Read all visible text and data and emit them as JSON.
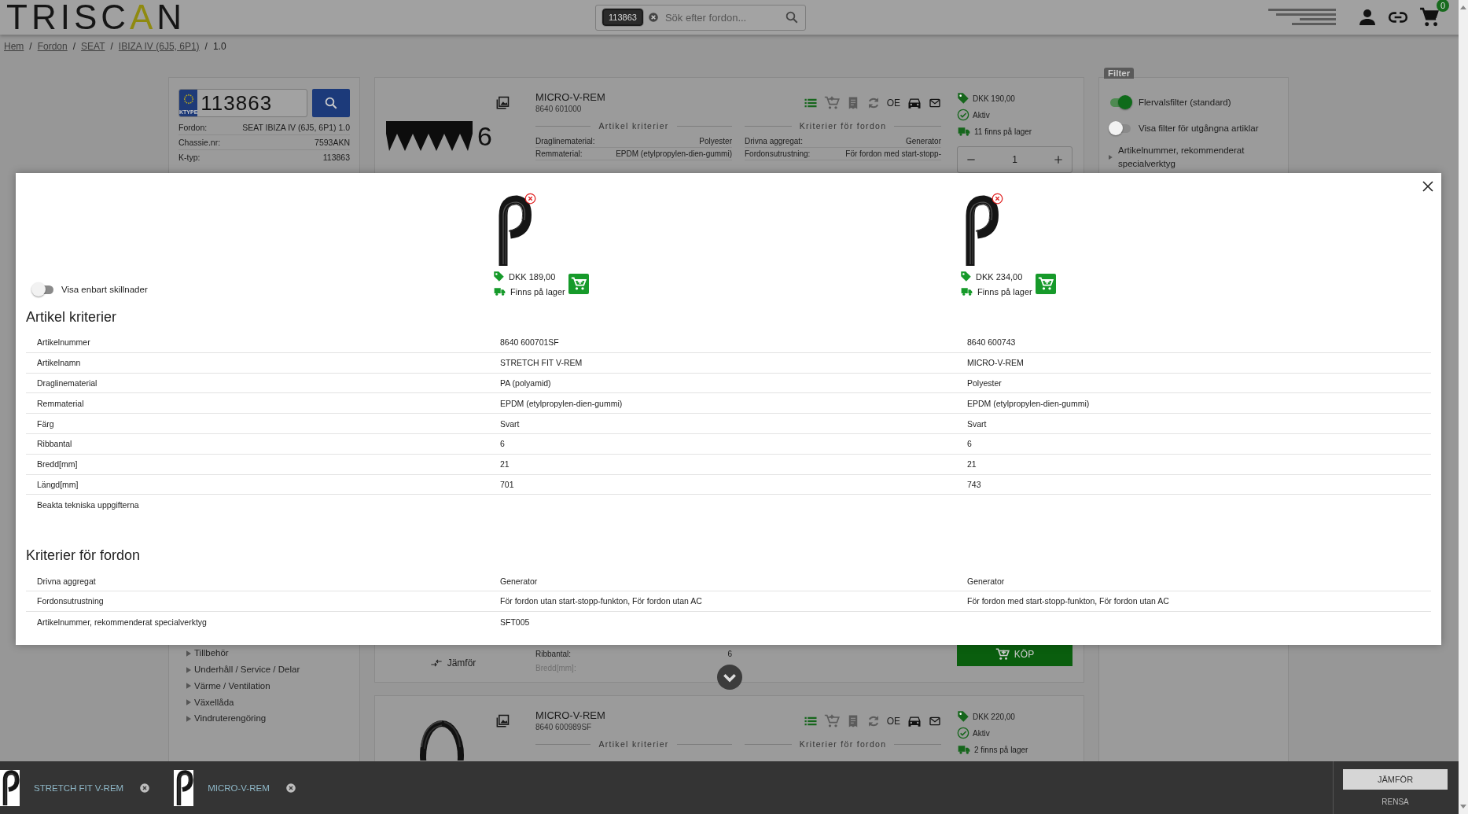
{
  "header": {
    "logo": [
      {
        "text": "TRISC",
        "accent": false
      },
      {
        "text": "A",
        "accent": true
      },
      {
        "text": "N",
        "accent": false
      }
    ],
    "search": {
      "chip": "113863",
      "placeholder": "Sök efter fordon..."
    },
    "cart_count": "0"
  },
  "breadcrumb": {
    "separator": "/",
    "items": [
      {
        "label": "Hem",
        "link": true
      },
      {
        "label": "Fordon",
        "link": true
      },
      {
        "label": "SEAT",
        "link": true
      },
      {
        "label": "IBIZA IV (6J5, 6P1)",
        "link": true
      },
      {
        "label": "1.0",
        "link": false
      }
    ]
  },
  "vehicle_panel": {
    "plate_badge": "KTYPE",
    "plate": "113863",
    "details": [
      {
        "label": "Fordon:",
        "value": "SEAT IBIZA IV (6J5, 6P1) 1.0"
      },
      {
        "label": "Chassie.nr:",
        "value": "7593AKN"
      },
      {
        "label": "K-typ:",
        "value": "113863"
      }
    ]
  },
  "categories": [
    {
      "label": "Tillbehör"
    },
    {
      "label": "Underhåll / Service / Delar"
    },
    {
      "label": "Värme / Ventilation"
    },
    {
      "label": "Växellåda"
    },
    {
      "label": "Vindruterengöring"
    }
  ],
  "products": [
    {
      "name": "MICRO-V-REM",
      "number": "8640 601000",
      "image": {
        "kind": "profile",
        "ribs": "6"
      },
      "article_heading": "Artikel kriterier",
      "vehicle_heading": "Kriterier för fordon",
      "toolbar": [
        {
          "kind": "list",
          "disabled": false
        },
        {
          "kind": "cart",
          "disabled": true
        },
        {
          "kind": "document",
          "disabled": true
        },
        {
          "kind": "refresh",
          "disabled": true
        },
        {
          "kind": "oe",
          "label": "OE",
          "disabled": false
        },
        {
          "kind": "car",
          "disabled": false
        },
        {
          "kind": "mail",
          "disabled": false
        }
      ],
      "article_criteria": [
        {
          "label": "Draglinematerial:",
          "value": "Polyester"
        },
        {
          "label": "Remmaterial:",
          "value": "EPDM (etylpropylen-dien-gummi)"
        }
      ],
      "vehicle_criteria": [
        {
          "label": "Drivna aggregat:",
          "value": "Generator"
        },
        {
          "label": "Fordonsutrustning:",
          "value": "För fordon med start-stopp-"
        }
      ],
      "price": "DKK 190,00",
      "status": "Aktiv",
      "stock": "11 finns på lager",
      "quantity": "1",
      "more_criteria": [
        {
          "label": "Ribbantal:",
          "value": "6",
          "faded": false
        },
        {
          "label": "Bredd[mm]:",
          "faded": true
        }
      ],
      "compare_label": "Jämför",
      "buy_label": "KÖP"
    },
    {
      "name": "MICRO-V-REM",
      "number": "8640 600989SF",
      "image": {
        "kind": "loop"
      },
      "article_heading": "Artikel kriterier",
      "vehicle_heading": "Kriterier för fordon",
      "toolbar": [
        {
          "kind": "list",
          "disabled": false
        },
        {
          "kind": "cart",
          "disabled": true
        },
        {
          "kind": "document",
          "disabled": true
        },
        {
          "kind": "refresh",
          "disabled": true
        },
        {
          "kind": "oe",
          "label": "OE",
          "disabled": false
        },
        {
          "kind": "car",
          "disabled": false
        },
        {
          "kind": "mail",
          "disabled": false
        }
      ],
      "price": "DKK 220,00",
      "status": "Aktiv",
      "stock": "2 finns på lager"
    }
  ],
  "filter": {
    "tag": "Filter",
    "toggles": [
      {
        "label": "Flervalsfilter (standard)",
        "on": true
      },
      {
        "label": "Visa filter för utgångna artiklar",
        "on": false
      }
    ],
    "groups": [
      {
        "label": "Artikelnummer, rekommenderat specialverktyg",
        "expanded": false
      }
    ]
  },
  "compare_modal": {
    "differences_toggle": {
      "label": "Visa enbart skillnader",
      "on": false
    },
    "products": [
      {
        "price": "DKK 189,00",
        "stock": "Finns på lager"
      },
      {
        "price": "DKK 234,00",
        "stock": "Finns på lager"
      }
    ],
    "sections": [
      {
        "title": "Artikel kriterier",
        "rows": [
          {
            "label": "Artikelnummer",
            "values": [
              "8640 600701SF",
              "8640 600743"
            ]
          },
          {
            "label": "Artikelnamn",
            "values": [
              "STRETCH FIT V-REM",
              "MICRO-V-REM"
            ]
          },
          {
            "label": "Draglinematerial",
            "values": [
              "PA (polyamid)",
              "Polyester"
            ]
          },
          {
            "label": "Remmaterial",
            "values": [
              "EPDM (etylpropylen-dien-gummi)",
              "EPDM (etylpropylen-dien-gummi)"
            ]
          },
          {
            "label": "Färg",
            "values": [
              "Svart",
              "Svart"
            ]
          },
          {
            "label": "Ribbantal",
            "values": [
              "6",
              "6"
            ]
          },
          {
            "label": "Bredd[mm]",
            "values": [
              "21",
              "21"
            ]
          },
          {
            "label": "Längd[mm]",
            "values": [
              "701",
              "743"
            ]
          },
          {
            "label": "Beakta tekniska uppgifterna"
          }
        ]
      },
      {
        "title": "Kriterier för fordon",
        "rows": [
          {
            "label": "Drivna aggregat",
            "values": [
              "Generator",
              "Generator"
            ]
          },
          {
            "label": "Fordonsutrustning",
            "values": [
              "För fordon utan start-stopp-funkton, För fordon utan AC",
              "För fordon med start-stopp-funkton, För fordon utan AC"
            ]
          },
          {
            "label": "Artikelnummer, rekommenderat specialverktyg",
            "values": [
              "SFT005"
            ]
          }
        ]
      }
    ]
  },
  "compare_bar": {
    "items": [
      {
        "name": "STRETCH FIT V-REM"
      },
      {
        "name": "MICRO-V-REM"
      }
    ],
    "compare_button": "JÄMFÖR",
    "clear_button": "RENSA"
  }
}
